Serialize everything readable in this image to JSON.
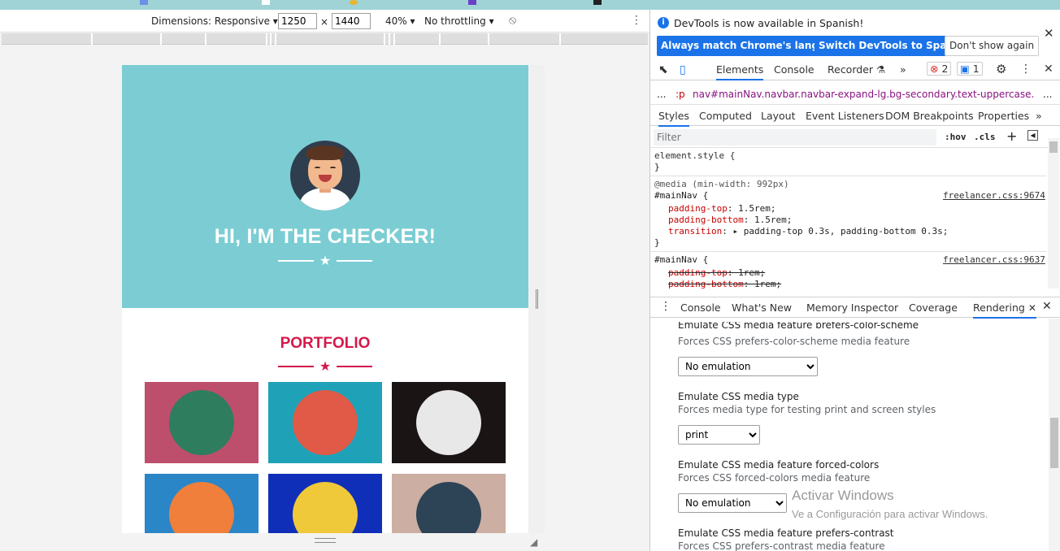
{
  "device_toolbar": {
    "dimensions_label": "Dimensions: Responsive",
    "width_value": "1250",
    "times": "×",
    "height_value": "1440",
    "zoom": "40%",
    "throttling": "No throttling",
    "rotate_icon": "rotate-icon",
    "more_icon": "more-vert-icon"
  },
  "page": {
    "hero_title": "HI, I'M THE CHECKER!",
    "hero_bg": "#7bcdd3",
    "star": "★",
    "portfolio_title": "PORTFOLIO",
    "portfolio_color": "#d4194a",
    "tiles": [
      {
        "name": "cabin",
        "bg": "#bd4f6c",
        "circle": "#2e7d5e"
      },
      {
        "name": "cake",
        "bg": "#1fa2b8",
        "circle": "#e05a47"
      },
      {
        "name": "circus",
        "bg": "#1a1414",
        "circle": "#e8e8e8"
      },
      {
        "name": "game-controller",
        "bg": "#2a86c7",
        "circle": "#ef7f3a"
      },
      {
        "name": "safe",
        "bg": "#0f2fb8",
        "circle": "#f0c93a"
      },
      {
        "name": "submarine",
        "bg": "#ccaea2",
        "circle": "#2d4356"
      }
    ]
  },
  "devtools": {
    "notice_text": "DevTools is now available in Spanish!",
    "btn_match": "Always match Chrome's language",
    "btn_switch": "Switch DevTools to Spanish",
    "btn_dont": "Don't show again",
    "tabs": [
      "Elements",
      "Console",
      "Recorder",
      "»"
    ],
    "errors": "2",
    "messages": "1",
    "breadcrumb_prefix": "...",
    "breadcrumb_short": ":p",
    "breadcrumb_node": "nav#mainNav.navbar.navbar-expand-lg.bg-secondary.text-uppercase.fixed-top",
    "breadcrumb_more": "...",
    "subtabs": [
      "Styles",
      "Computed",
      "Layout",
      "Event Listeners",
      "DOM Breakpoints",
      "Properties",
      "»"
    ],
    "filter_placeholder": "Filter",
    "hov": ":hov",
    "cls": ".cls",
    "plus": "+",
    "code": {
      "l1": "element.style {",
      "l2": "}",
      "media": "@media (min-width: 992px)",
      "sel1": "#mainNav {",
      "link1": "freelancer.css:9674",
      "p1": "padding-top",
      "v1": "1.5rem;",
      "p2": "padding-bottom",
      "v2": "1.5rem;",
      "p3": "transition",
      "v3": "padding-top 0.3s, padding-bottom 0.3s;",
      "close1": "}",
      "sel2": "#mainNav {",
      "link2": "freelancer.css:9637",
      "p4": "padding-top",
      "v4": "1rem;",
      "p5": "padding-bottom",
      "v5": "1rem;"
    },
    "drawer_tabs": [
      "Console",
      "What's New",
      "Memory Inspector",
      "Coverage",
      "Rendering"
    ],
    "rendering": {
      "h0": "Emulate CSS media feature prefers-color-scheme",
      "d0": "Forces CSS prefers-color-scheme media feature",
      "s0": "No emulation",
      "h1": "Emulate CSS media type",
      "d1": "Forces media type for testing print and screen styles",
      "s1": "print",
      "h2": "Emulate CSS media feature forced-colors",
      "d2": "Forces CSS forced-colors media feature",
      "s2": "No emulation",
      "h3": "Emulate CSS media feature prefers-contrast",
      "d3": "Forces CSS prefers-contrast media feature"
    }
  },
  "watermark": {
    "title": "Activar Windows",
    "sub": "Ve a Configuración para activar Windows."
  }
}
